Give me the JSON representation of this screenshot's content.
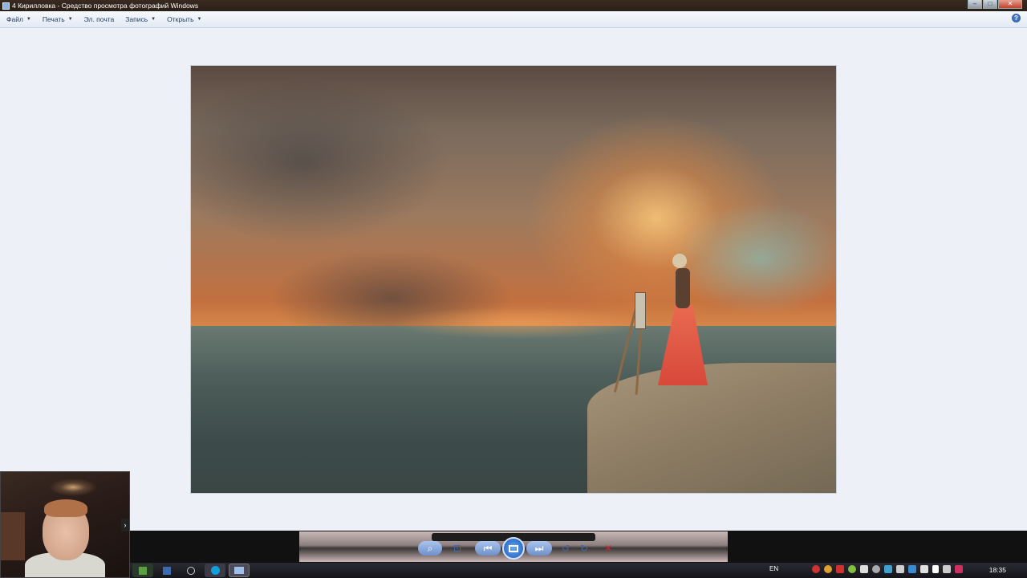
{
  "window": {
    "title": "4 Кирилловка - Средство просмотра фотографий Windows",
    "min_glyph": "–",
    "max_glyph": "□",
    "close_glyph": "✕"
  },
  "menubar": {
    "items": [
      {
        "label": "Файл",
        "has_caret": true
      },
      {
        "label": "Печать",
        "has_caret": true
      },
      {
        "label": "Эл. почта",
        "has_caret": false
      },
      {
        "label": "Запись",
        "has_caret": true
      },
      {
        "label": "Открыть",
        "has_caret": true
      }
    ],
    "caret_glyph": "▼",
    "help_glyph": "?"
  },
  "controls": {
    "zoom_glyph": "⌕",
    "actual_size_glyph": "⊡",
    "previous_glyph": "⏮",
    "next_glyph": "⏭",
    "rotate_left_glyph": "↺",
    "rotate_right_glyph": "↻",
    "delete_glyph": "✕"
  },
  "taskbar": {
    "language": "EN",
    "time": "18:35"
  },
  "colors": {
    "accent": "#3d6bb8",
    "delete": "#d0232a"
  }
}
